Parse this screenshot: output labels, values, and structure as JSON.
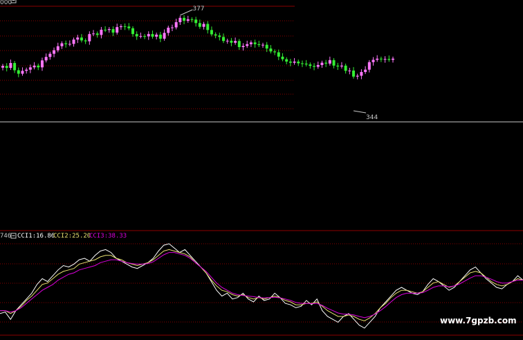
{
  "header": {
    "top_value": "000",
    "collapse_icon": "minus-box-icon"
  },
  "colors": {
    "background": "#000000",
    "grid": "#8b0000",
    "separator": "#c8c8c8",
    "candle_up": "#ff77ff",
    "candle_down": "#33ee33",
    "cci1": "#ffffff",
    "cci2": "#e8e070",
    "cci3": "#dd00dd"
  },
  "chart_data": [
    {
      "type": "candlestick",
      "annotations": [
        {
          "text": "377",
          "kind": "high",
          "value": 377
        },
        {
          "text": "344",
          "kind": "low",
          "value": 344
        }
      ],
      "grid": true,
      "close": [
        359.5,
        358.8,
        360.5,
        358.0,
        356.8,
        357.8,
        358.2,
        359.0,
        359.6,
        359.0,
        361.4,
        362.6,
        363.7,
        364.9,
        366.3,
        367.3,
        367.0,
        367.1,
        368.6,
        369.3,
        368.3,
        368.0,
        370.5,
        370.7,
        370.2,
        372.0,
        371.9,
        372.2,
        371.0,
        372.9,
        373.2,
        373.1,
        372.5,
        370.5,
        369.7,
        369.8,
        369.7,
        370.5,
        369.6,
        370.3,
        368.9,
        370.9,
        372.7,
        372.8,
        374.6,
        376.1,
        375.1,
        375.6,
        375.5,
        374.3,
        373.0,
        374.0,
        371.9,
        370.4,
        370.0,
        369.5,
        368.1,
        368.2,
        367.5,
        368.1,
        366.0,
        366.4,
        367.0,
        367.6,
        367.0,
        366.7,
        366.8,
        365.5,
        364.5,
        364.2,
        362.7,
        361.8,
        361.0,
        360.6,
        361.0,
        360.4,
        360.3,
        360.0,
        359.5,
        359.2,
        359.8,
        360.6,
        360.3,
        361.5,
        359.6,
        359.3,
        359.6,
        357.8,
        357.9,
        355.8,
        356.1,
        357.4,
        358.2,
        360.8,
        361.6,
        362.0,
        361.8,
        361.9,
        361.6,
        362.0
      ]
    },
    {
      "type": "line",
      "series": [
        {
          "name": "CCI1",
          "value_label": "16.86"
        },
        {
          "name": "CCI2",
          "value_label": "25.20"
        },
        {
          "name": "CCI3",
          "value_label": "38.33"
        }
      ],
      "axis_label": "746",
      "grid": true,
      "series_values": {
        "cci1": [
          -90,
          -85,
          -110,
          -80,
          -60,
          -40,
          -20,
          10,
          30,
          20,
          40,
          60,
          75,
          70,
          80,
          95,
          100,
          90,
          110,
          125,
          130,
          120,
          100,
          90,
          80,
          70,
          65,
          75,
          85,
          100,
          125,
          145,
          150,
          135,
          120,
          130,
          110,
          90,
          70,
          50,
          20,
          -10,
          -30,
          -20,
          -40,
          -35,
          -20,
          -40,
          -50,
          -30,
          -45,
          -40,
          -20,
          -35,
          -55,
          -60,
          -70,
          -65,
          -45,
          -60,
          -40,
          -80,
          -100,
          -110,
          -120,
          -100,
          -90,
          -110,
          -130,
          -140,
          -120,
          -100,
          -70,
          -50,
          -30,
          -10,
          0,
          -10,
          -20,
          -25,
          -15,
          10,
          30,
          20,
          5,
          -10,
          0,
          20,
          40,
          60,
          70,
          50,
          30,
          15,
          0,
          -5,
          10,
          20,
          40,
          25
        ],
        "cci2": [
          -80,
          -80,
          -90,
          -80,
          -65,
          -45,
          -30,
          -10,
          10,
          15,
          30,
          45,
          55,
          60,
          65,
          80,
          85,
          90,
          95,
          105,
          110,
          110,
          100,
          95,
          85,
          80,
          75,
          80,
          85,
          95,
          110,
          125,
          130,
          125,
          120,
          115,
          105,
          85,
          70,
          50,
          25,
          5,
          -10,
          -15,
          -25,
          -30,
          -25,
          -35,
          -40,
          -35,
          -40,
          -35,
          -30,
          -35,
          -45,
          -50,
          -60,
          -60,
          -55,
          -55,
          -50,
          -65,
          -80,
          -90,
          -100,
          -100,
          -95,
          -100,
          -110,
          -115,
          -105,
          -90,
          -70,
          -55,
          -35,
          -20,
          -10,
          -10,
          -15,
          -20,
          -15,
          0,
          15,
          20,
          10,
          0,
          5,
          20,
          35,
          50,
          55,
          50,
          35,
          20,
          10,
          5,
          10,
          20,
          30,
          25
        ],
        "cci3": [
          -80,
          -80,
          -85,
          -80,
          -70,
          -55,
          -40,
          -25,
          -10,
          0,
          10,
          25,
          35,
          45,
          50,
          60,
          65,
          70,
          75,
          85,
          90,
          95,
          95,
          90,
          85,
          82,
          80,
          80,
          82,
          88,
          100,
          112,
          120,
          120,
          115,
          110,
          100,
          85,
          70,
          55,
          35,
          15,
          0,
          -10,
          -20,
          -25,
          -28,
          -30,
          -32,
          -35,
          -36,
          -35,
          -34,
          -36,
          -40,
          -45,
          -52,
          -55,
          -55,
          -56,
          -55,
          -62,
          -72,
          -80,
          -88,
          -92,
          -92,
          -95,
          -100,
          -104,
          -100,
          -92,
          -80,
          -66,
          -50,
          -35,
          -25,
          -20,
          -20,
          -20,
          -18,
          -10,
          0,
          5,
          5,
          2,
          5,
          12,
          22,
          32,
          40,
          40,
          35,
          28,
          20,
          15,
          15,
          20,
          25,
          25
        ]
      }
    }
  ],
  "watermark": "www.7gpzb.com"
}
